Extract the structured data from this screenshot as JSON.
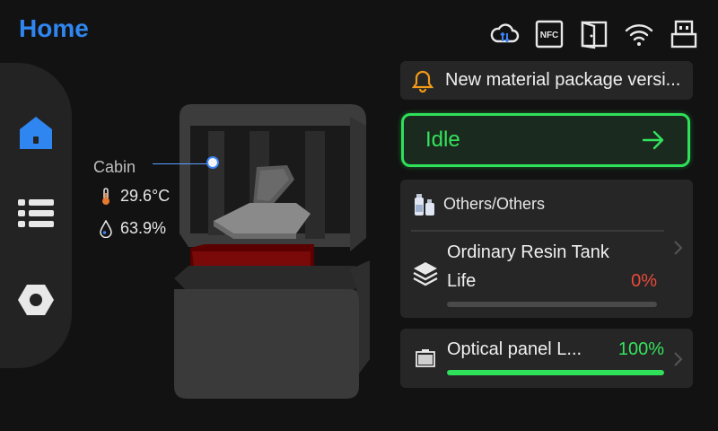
{
  "header": {
    "title": "Home"
  },
  "status_icons": [
    "cloud-sync-icon",
    "nfc-icon",
    "door-icon",
    "wifi-icon",
    "usb-icon"
  ],
  "status_icon_labels": {
    "nfc": "NFC"
  },
  "sidebar": {
    "items": [
      "home-icon",
      "list-icon",
      "settings-icon"
    ],
    "active": "home"
  },
  "cabin": {
    "label": "Cabin",
    "temperature": "29.6°C",
    "humidity": "63.9%"
  },
  "notice": {
    "text": "New material package versi..."
  },
  "status": {
    "label": "Idle"
  },
  "material": {
    "name": "Others/Others",
    "tank_name": "Ordinary Resin Tank",
    "life_label": "Life",
    "life_value": "0%",
    "life_fraction": 0.0
  },
  "optical": {
    "name": "Optical panel L...",
    "value": "100%",
    "fraction": 1.0
  },
  "colors": {
    "accent": "#2f86f0",
    "ok": "#34e35c",
    "warn": "#e84a3b",
    "bell": "#f29a1a"
  }
}
